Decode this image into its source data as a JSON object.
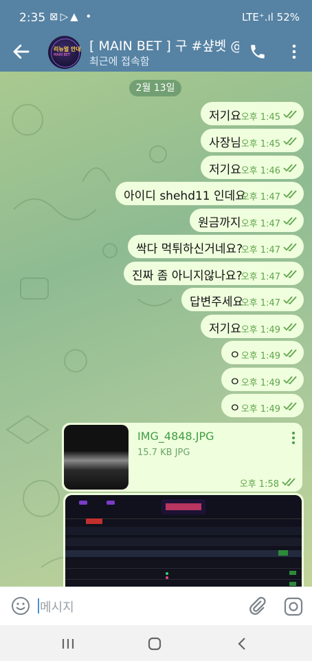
{
  "status_bar": {
    "time": "2:35",
    "left_icons": "⊠▷▲ •",
    "right_text": "LTE⁺.ıl 52%"
  },
  "header": {
    "title": "[ MAIN BET ] 구 #샾벳 @",
    "subtitle": "최근에 접속함"
  },
  "avatar": {
    "line1": "리뉴얼 안내",
    "line2": "MAIN BET"
  },
  "date_chip": "2월 13일",
  "messages": [
    {
      "text": "저기요",
      "time": "오후 1:45"
    },
    {
      "text": "사장님",
      "time": "오후 1:45"
    },
    {
      "text": "저기요",
      "time": "오후 1:46"
    },
    {
      "text": "아이디 shehd11 인데요",
      "time": "오후 1:47"
    },
    {
      "text": "원금까지",
      "time": "오후 1:47"
    },
    {
      "text": "싹다 먹튀하신거네요?",
      "time": "오후 1:47"
    },
    {
      "text": "진짜 좀 아니지않나요?",
      "time": "오후 1:47"
    },
    {
      "text": "답변주세요",
      "time": "오후 1:47"
    },
    {
      "text": "저기요",
      "time": "오후 1:49"
    },
    {
      "text": "ㅇ",
      "time": "오후 1:49"
    },
    {
      "text": "ㅇ",
      "time": "오후 1:49"
    },
    {
      "text": "ㅇ",
      "time": "오후 1:49"
    }
  ],
  "file_message": {
    "name": "IMG_4848.JPG",
    "meta": "15.7 KB JPG",
    "time": "오후 1:58"
  },
  "input": {
    "placeholder": "메시지"
  },
  "colors": {
    "header": "#5682a3",
    "bubble": "#effedd",
    "time": "#5ea54a",
    "file_name": "#3e9d43"
  }
}
